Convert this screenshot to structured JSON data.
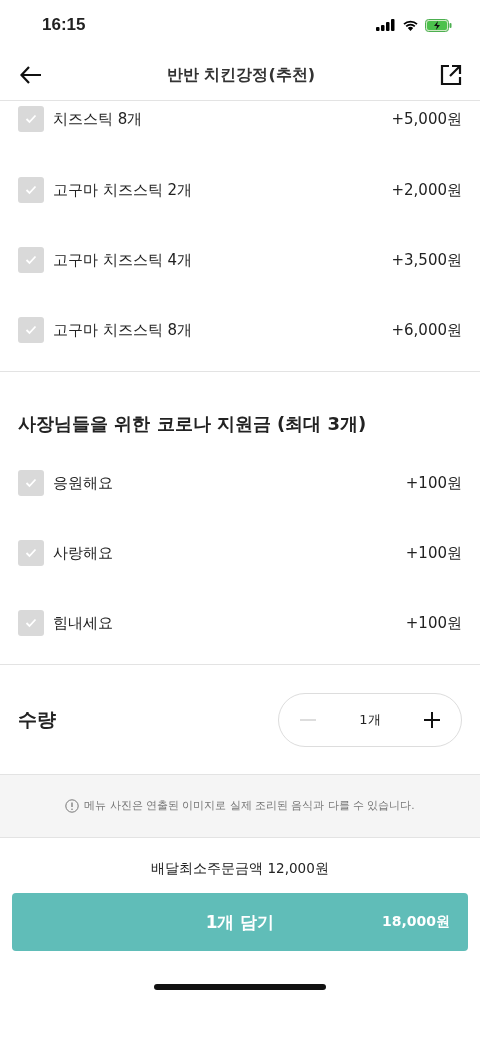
{
  "status_bar": {
    "time": "16:15"
  },
  "nav": {
    "title": "반반 치킨강정(추천)"
  },
  "option_groups": [
    {
      "options": [
        {
          "label": "치즈스틱 8개",
          "price": "+5,000원",
          "checked": false
        },
        {
          "label": "고구마 치즈스틱 2개",
          "price": "+2,000원",
          "checked": false
        },
        {
          "label": "고구마 치즈스틱 4개",
          "price": "+3,500원",
          "checked": false
        },
        {
          "label": "고구마 치즈스틱 8개",
          "price": "+6,000원",
          "checked": false
        }
      ]
    },
    {
      "title": "사장님들을 위한 코로나 지원금 (최대 3개)",
      "options": [
        {
          "label": "응원해요",
          "price": "+100원",
          "checked": false
        },
        {
          "label": "사랑해요",
          "price": "+100원",
          "checked": false
        },
        {
          "label": "힘내세요",
          "price": "+100원",
          "checked": false
        }
      ]
    }
  ],
  "quantity": {
    "label": "수량",
    "value": "1개",
    "decrease_disabled": true
  },
  "notice": "메뉴 사진은 연출된 이미지로 실제 조리된 음식과 다를 수 있습니다.",
  "min_order": "배달최소주문금액 12,000원",
  "cart_button": {
    "label": "1개 담기",
    "price": "18,000원"
  }
}
